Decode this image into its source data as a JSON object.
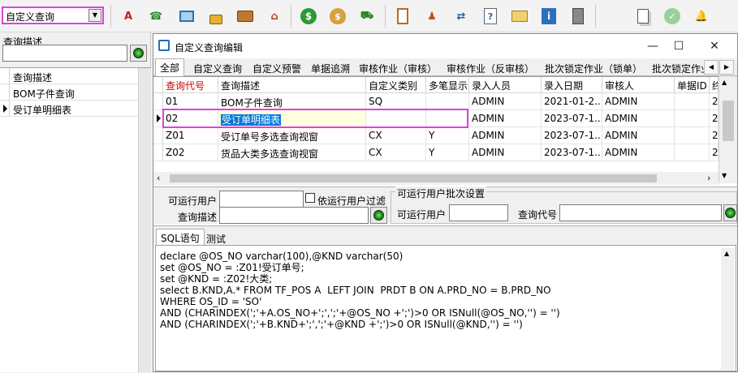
{
  "toolbar": {
    "combo_value": "自定义查询",
    "icons": [
      "spell-check-icon",
      "phone-icon",
      "monitor-icon",
      "lock-icon",
      "briefcase-icon",
      "home-icon",
      "dollar-icon",
      "money-bag-icon",
      "cart-icon",
      "clipboard-icon",
      "users-icon",
      "exchange-icon",
      "help-icon",
      "mail-icon",
      "info-icon",
      "calculator-icon",
      "copy-icon",
      "check-icon",
      "bell-icon"
    ]
  },
  "left_panel": {
    "label": "查询描述",
    "search_value": "",
    "grid_header": "查询描述",
    "items": [
      "BOM子件查询",
      "受订单明细表"
    ]
  },
  "window": {
    "title": "自定义查询编辑",
    "min": "—",
    "max": "☐",
    "close": "✕",
    "tabs": [
      "全部",
      "自定义查询",
      "自定义预警",
      "单据追溯",
      "审核作业（审核）",
      "审核作业（反审核）",
      "批次锁定作业（锁单）",
      "批次锁定作业"
    ],
    "grid": {
      "columns": [
        "查询代号",
        "查询描述",
        "自定义类别",
        "多笔显示",
        "录入人员",
        "录入日期",
        "审核人",
        "单据ID",
        "终"
      ],
      "rows": [
        [
          "01",
          "BOM子件查询",
          "SQ",
          "",
          "ADMIN",
          "2021-01-2...",
          "ADMIN",
          "",
          "2"
        ],
        [
          "02",
          "受订单明细表",
          "",
          "",
          "ADMIN",
          "2023-07-1...",
          "ADMIN",
          "",
          "2"
        ],
        [
          "Z01",
          "受订单号多选查询视窗",
          "CX",
          "Y",
          "ADMIN",
          "2023-07-1...",
          "ADMIN",
          "",
          "2"
        ],
        [
          "Z02",
          "货品大类多选查询视窗",
          "CX",
          "Y",
          "ADMIN",
          "2023-07-1...",
          "ADMIN",
          "",
          "2"
        ]
      ]
    },
    "filters": {
      "run_user_label": "可运行用户",
      "run_user_value": "",
      "filter_checkbox_label": "依运行用户过滤",
      "query_desc_label": "查询描述",
      "query_desc_value": "",
      "batch_group_label": "可运行用户批次设置",
      "batch_user_label": "可运行用户",
      "batch_user_value": "",
      "query_code_label": "查询代号",
      "query_code_value": ""
    },
    "sql_tabs": [
      "SQL语句",
      "测试"
    ],
    "sql_lines": [
      "declare @OS_NO varchar(100),@KND varchar(50)",
      "set @OS_NO = :Z01!受订单号;",
      "set @KND = :Z02!大类;",
      "select B.KND,A.* FROM TF_POS A  LEFT JOIN  PRDT B ON A.PRD_NO = B.PRD_NO",
      "WHERE OS_ID = 'SO'",
      "AND (CHARINDEX(';'+A.OS_NO+';',';'+@OS_NO +';')>0 OR ISNull(@OS_NO,'') = '')",
      "AND (CHARINDEX(';'+B.KND+';',';'+@KND +';')>0 OR ISNull(@KND,'') = '')"
    ]
  }
}
